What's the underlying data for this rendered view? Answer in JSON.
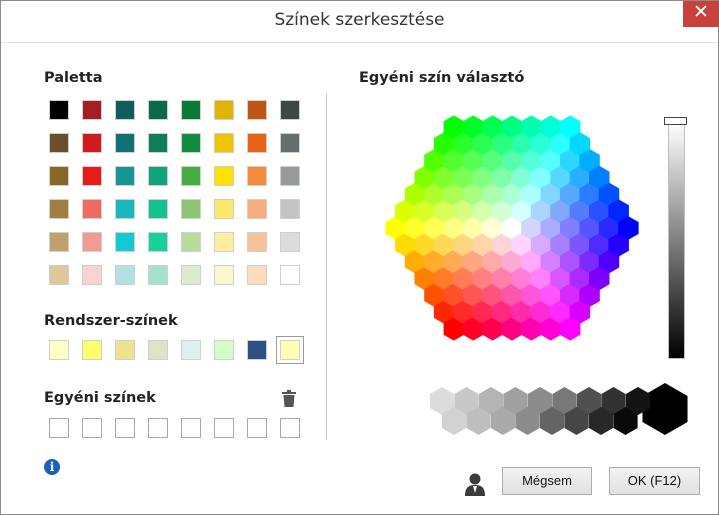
{
  "window": {
    "title": "Színek szerkesztése",
    "close_icon": "close-icon"
  },
  "palette": {
    "heading": "Paletta",
    "rows": [
      [
        "#000000",
        "#a31f24",
        "#0e5d5f",
        "#0a6b4c",
        "#0a7a37",
        "#e0b400",
        "#bf5616",
        "#3e4648"
      ],
      [
        "#6b4e2c",
        "#d11a1f",
        "#127173",
        "#0e7e5a",
        "#128c3c",
        "#f0c300",
        "#e46317",
        "#686e70"
      ],
      [
        "#8a6727",
        "#e81b1b",
        "#179696",
        "#11a37a",
        "#45ac44",
        "#fee100",
        "#f28b3a",
        "#989b9c"
      ],
      [
        "#a27d42",
        "#ef6a61",
        "#1ab7bd",
        "#14c290",
        "#8ec472",
        "#fbe86a",
        "#f5ad7c",
        "#c2c3c3"
      ],
      [
        "#c2a06c",
        "#f49a94",
        "#11cad3",
        "#19d09a",
        "#b8db9a",
        "#fcf09f",
        "#f5c399",
        "#dadcdb"
      ],
      [
        "#dfc89a",
        "#f7d3d6",
        "#b4e0e3",
        "#a3e2cd",
        "#dcebcd",
        "#fdf7d0",
        "#fbdcbc",
        "#ffffff"
      ]
    ]
  },
  "system": {
    "heading": "Rendszer-színek",
    "colors": [
      "#ffffc8",
      "#ffff6e",
      "#f0e18f",
      "#e1e1c8",
      "#dcf0f0",
      "#d2ffc8",
      "#2d5082",
      "#ffffb4"
    ],
    "selected_index": 7
  },
  "custom": {
    "heading": "Egyéni színek",
    "slots": 8,
    "trash_icon": "trash-icon"
  },
  "picker": {
    "heading": "Egyéni szín választó",
    "brightness_level": 0.0
  },
  "buttons": {
    "cancel": "Mégsem",
    "ok": "OK (F12)"
  },
  "icons": {
    "info": "info-icon",
    "user": "user-icon"
  }
}
